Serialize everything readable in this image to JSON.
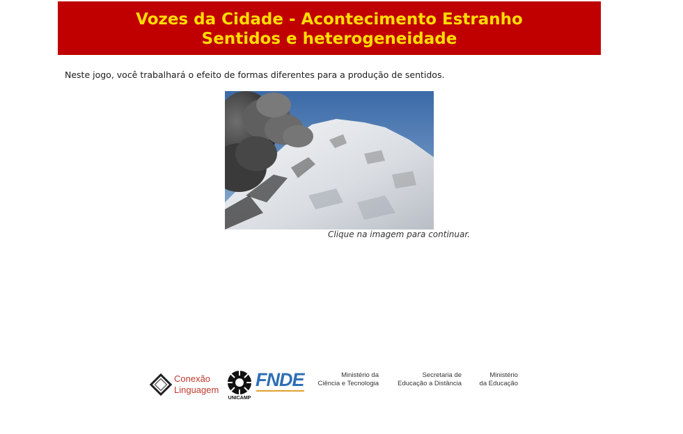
{
  "header": {
    "title_line1": "Vozes da Cidade - Acontecimento Estranho",
    "title_line2": "Sentidos e heterogeneidade"
  },
  "main": {
    "intro_text": "Neste jogo, você trabalhará o efeito de formas diferentes para a produção de sentidos.",
    "image_caption": "Clique na imagem para continuar."
  },
  "footer": {
    "conexao_line1": "Conexão",
    "conexao_line2": "Linguagem",
    "unicamp_label": "UNICAMP",
    "fnde_label": "FNDE",
    "mct_line1": "Ministério da",
    "mct_line2": "Ciência e Tecnologia",
    "sed_line1": "Secretaria de",
    "sed_line2": "Educação a Distância",
    "mec_line1": "Ministério",
    "mec_line2": "da Educação"
  },
  "colors": {
    "banner_bg": "#c00000",
    "banner_text": "#ffdd00",
    "fnde_blue": "#2f6fb5",
    "conexao_red": "#c0392b"
  }
}
